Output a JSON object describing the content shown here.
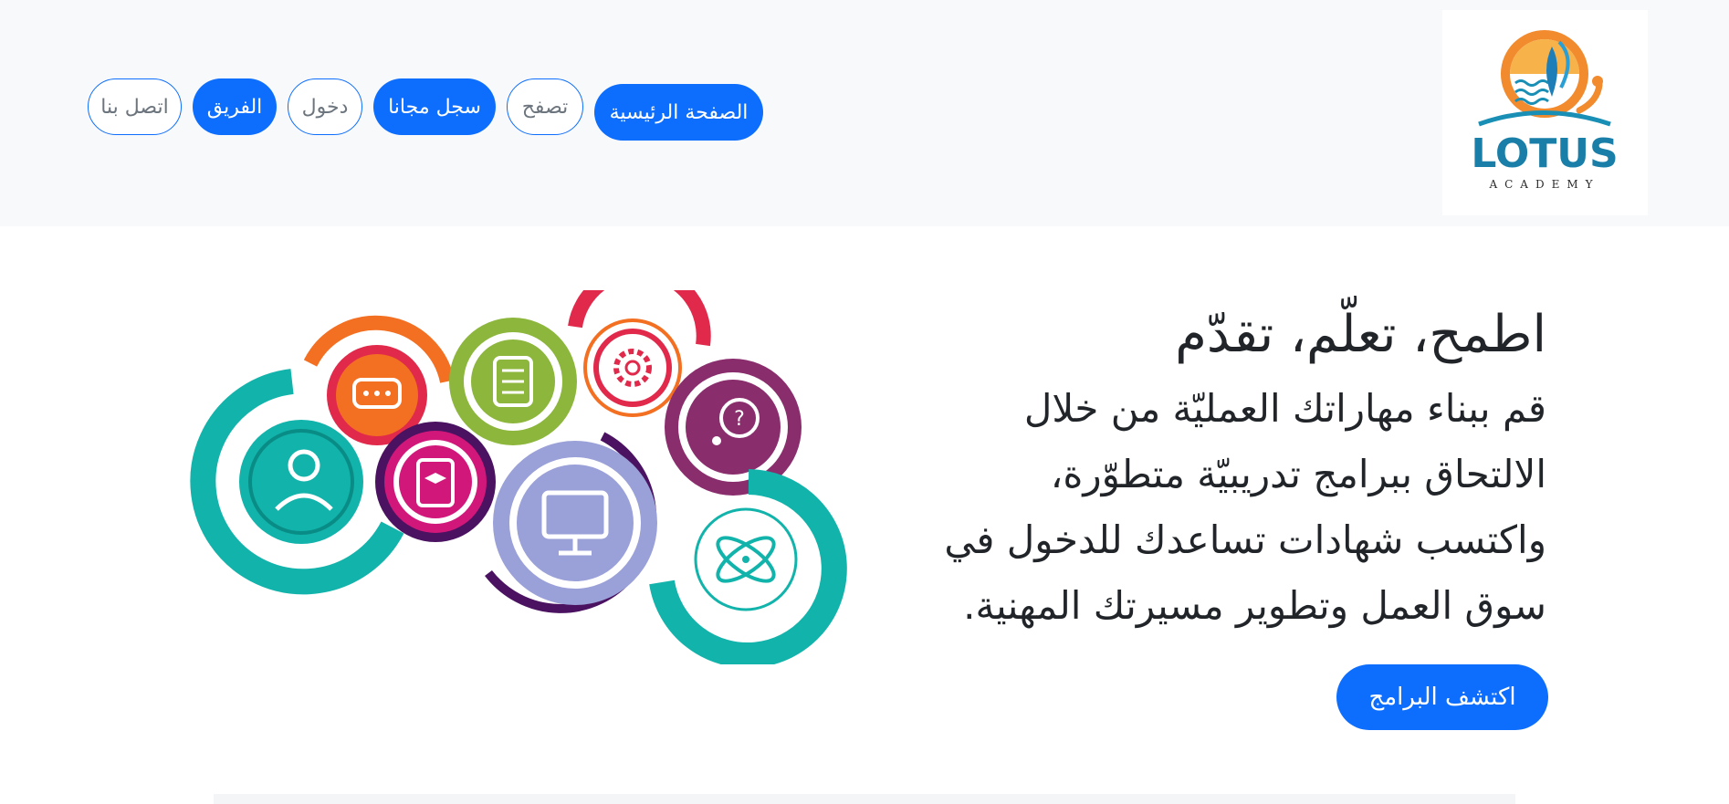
{
  "header": {
    "logo": {
      "brand": "LOTUS",
      "sub": "ACADEMY",
      "icon": "lotus-logo"
    },
    "nav": {
      "home": "الصفحة الرئيسية",
      "browse": "تصفح",
      "signup": "سجل مجانا",
      "login": "دخول",
      "team": "الفريق",
      "contact": "اتصل بنا"
    }
  },
  "hero": {
    "title": "اطمح، تعلّم، تقدّم",
    "subtitle_lines": [
      "قم ببناء مهاراتك العمليّة من خلال",
      "الالتحاق ببرامج تدريبيّة متطوّرة،",
      "واكتسب شهادات تساعدك للدخول في",
      "سوق العمل وتطوير مسيرتك المهنية."
    ],
    "cta": "اكتشف البرامج",
    "illustration": "education-circles-illustration"
  },
  "colors": {
    "primary": "#0d6efd",
    "topbar_bg": "#f8f9fa",
    "text": "#212529",
    "teal": "#12b3ab",
    "orange": "#f36f21",
    "green": "#8db63c",
    "red": "#e12a4b",
    "purple": "#8a2d6d",
    "magenta": "#d1177a",
    "lavender": "#9aa0d8"
  }
}
